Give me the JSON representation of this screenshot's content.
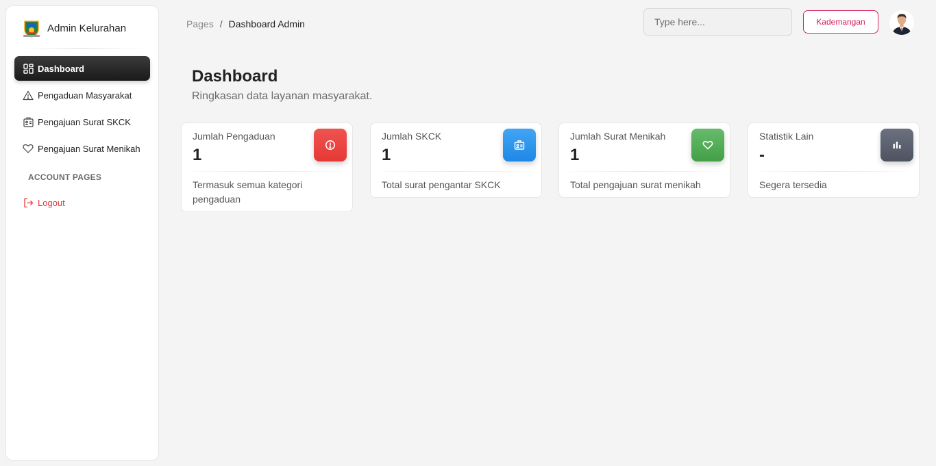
{
  "sidebar": {
    "brand": "Admin Kelurahan",
    "items": [
      {
        "label": "Dashboard",
        "icon": "dashboard-icon"
      },
      {
        "label": "Pengaduan Masyarakat",
        "icon": "warning-icon"
      },
      {
        "label": "Pengajuan Surat SKCK",
        "icon": "id-card-icon"
      },
      {
        "label": "Pengajuan Surat Menikah",
        "icon": "heart-icon"
      }
    ],
    "section_title": "ACCOUNT PAGES",
    "logout": {
      "label": "Logout",
      "icon": "logout-icon"
    }
  },
  "header": {
    "breadcrumb_root": "Pages",
    "breadcrumb_sep": "/",
    "breadcrumb_current": "Dashboard Admin",
    "search_placeholder": "Type here...",
    "user_button": "Kademangan"
  },
  "main": {
    "title": "Dashboard",
    "subtitle": "Ringkasan data layanan masyarakat."
  },
  "cards": [
    {
      "label": "Jumlah Pengaduan",
      "value": "1",
      "footer": "Termasuk semua kategori pengaduan",
      "icon": "alert-circle-icon",
      "color": "#e53935"
    },
    {
      "label": "Jumlah SKCK",
      "value": "1",
      "footer": "Total surat pengantar SKCK",
      "icon": "id-badge-icon",
      "color": "#1e88e5"
    },
    {
      "label": "Jumlah Surat Menikah",
      "value": "1",
      "footer": "Total pengajuan surat menikah",
      "icon": "heart-icon",
      "color": "#43a047"
    },
    {
      "label": "Statistik Lain",
      "value": "-",
      "footer": "Segera tersedia",
      "icon": "bar-chart-icon",
      "color": "#5f6470"
    }
  ],
  "colors": {
    "accent": "#d81b60",
    "logout": "#e53935",
    "active_nav": "#1f1f1f"
  }
}
